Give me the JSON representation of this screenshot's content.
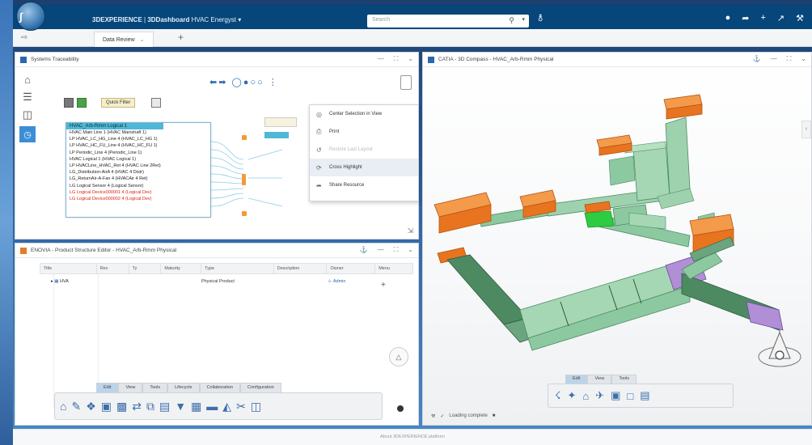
{
  "app": {
    "brand": "3DEXPERIENCE",
    "dashboard": "3DDashboard",
    "title": "HVAC Energyst",
    "search_placeholder": "Search"
  },
  "tabs": [
    {
      "label": "Data Review"
    }
  ],
  "systems_panel": {
    "title": "Systems Traceability",
    "filter_label": "Quick Filter",
    "node_title": "HVAC_Arb-Rmm Logical 1",
    "node_rows": [
      "HVAC Main Line 1 (HVAC Mainshaft 1)",
      "LP HVAC_LC_HG_Line 4 (HVAC_LC_HG 1)",
      "LP HVAC_HC_FU_Line 4 (HVAC_HC_FU 1)",
      "LP Periodic_Line 4 (Periodic_Line 1)",
      "HVAC Logical 1 (HVAC Logical 1)",
      "LP HVACLine_HVAC_Ret 4 (HVAC Line 2Ret)",
      "LG_Distribution-AirA 4 (HVAC 4 Distr)",
      "LG_ReturnAir-A-Fan 4 (HVACAir 4 Ret)",
      "LG Logical Sensor 4 (Logical Sensor)",
      "LG Logical Device000001 4 (Logical Dev)",
      "LG Logical Device000002 4 (Logical Dev)"
    ],
    "node_rows_red": [
      9,
      10
    ],
    "context_menu": [
      {
        "label": "Center Selection in View",
        "icon": "center-icon",
        "disabled": false
      },
      {
        "label": "Print",
        "icon": "print-icon",
        "disabled": false
      },
      {
        "label": "Restore Last Layout",
        "icon": "restore-icon",
        "disabled": true
      },
      {
        "label": "Cross Highlight",
        "icon": "highlight-icon",
        "disabled": false,
        "hover": true
      },
      {
        "label": "Share Resource",
        "icon": "share-icon",
        "disabled": false
      }
    ]
  },
  "structure_panel": {
    "title": "ENOVIA - Product Structure Editor - HVAC_Arb-Rmm Physical",
    "columns": [
      "Title",
      "Rev",
      "Ty",
      "Maturity",
      "Type",
      "Description",
      "Owner",
      "Menu"
    ],
    "row": {
      "title": "HVA",
      "maturity": "In Work",
      "type": "Physical Product",
      "owner": "Admin"
    },
    "actionbar_tabs": [
      "Edit",
      "View",
      "Tools",
      "Lifecycle",
      "Collaboration",
      "Configuration"
    ],
    "actionbar_active": "Edit"
  },
  "viewer_panel": {
    "title": "CATIA - 3D Compass - HVAC_Arb-Rmm Physical",
    "tabs": [
      "Edit",
      "View",
      "Tools"
    ],
    "active_tab": "Edit",
    "status": "Loading complete"
  },
  "footer": "About 3DEXPERIENCE platform",
  "colors": {
    "topbar": "#06467a",
    "accent": "#3b8ed6",
    "duct_green": "#8cc9a0",
    "duct_dark": "#4d8a62",
    "equipment_orange": "#e8741f",
    "highlight_green": "#2ecc40"
  }
}
